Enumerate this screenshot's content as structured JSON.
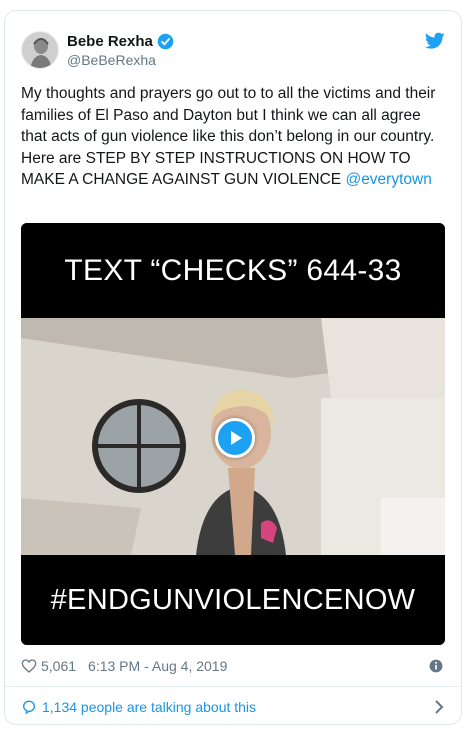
{
  "tweet": {
    "display_name": "Bebe Rexha",
    "handle": "@BeBeRexha",
    "verified": true,
    "text": "My thoughts and prayers go out to to all the victims and their families of El Paso and Dayton but I think we can all agree that acts of gun violence like this don’t belong in our country. Here are STEP BY STEP INSTRUCTIONS ON HOW TO MAKE A CHANGE AGAINST GUN VIOLENCE",
    "mention": "@everytown",
    "likes": "5,061",
    "timestamp": "6:13 PM - Aug 4, 2019",
    "conversation_text": "1,134 people are talking about this"
  },
  "video": {
    "caption_top": "TEXT “CHECKS” 644-33",
    "caption_bottom": "#ENDGUNVIOLENCENOW"
  },
  "icons": {
    "brand": "twitter-bird",
    "verified": "verified-badge",
    "like": "heart-outline",
    "info": "info-circle",
    "conversation": "speech-bubble",
    "more": "chevron-right",
    "play": "play-triangle"
  },
  "colors": {
    "brand_blue": "#1da1f2",
    "link_blue": "#1b95e0",
    "text_primary": "#14171a",
    "text_secondary": "#657786",
    "border": "#e1e8ed"
  }
}
